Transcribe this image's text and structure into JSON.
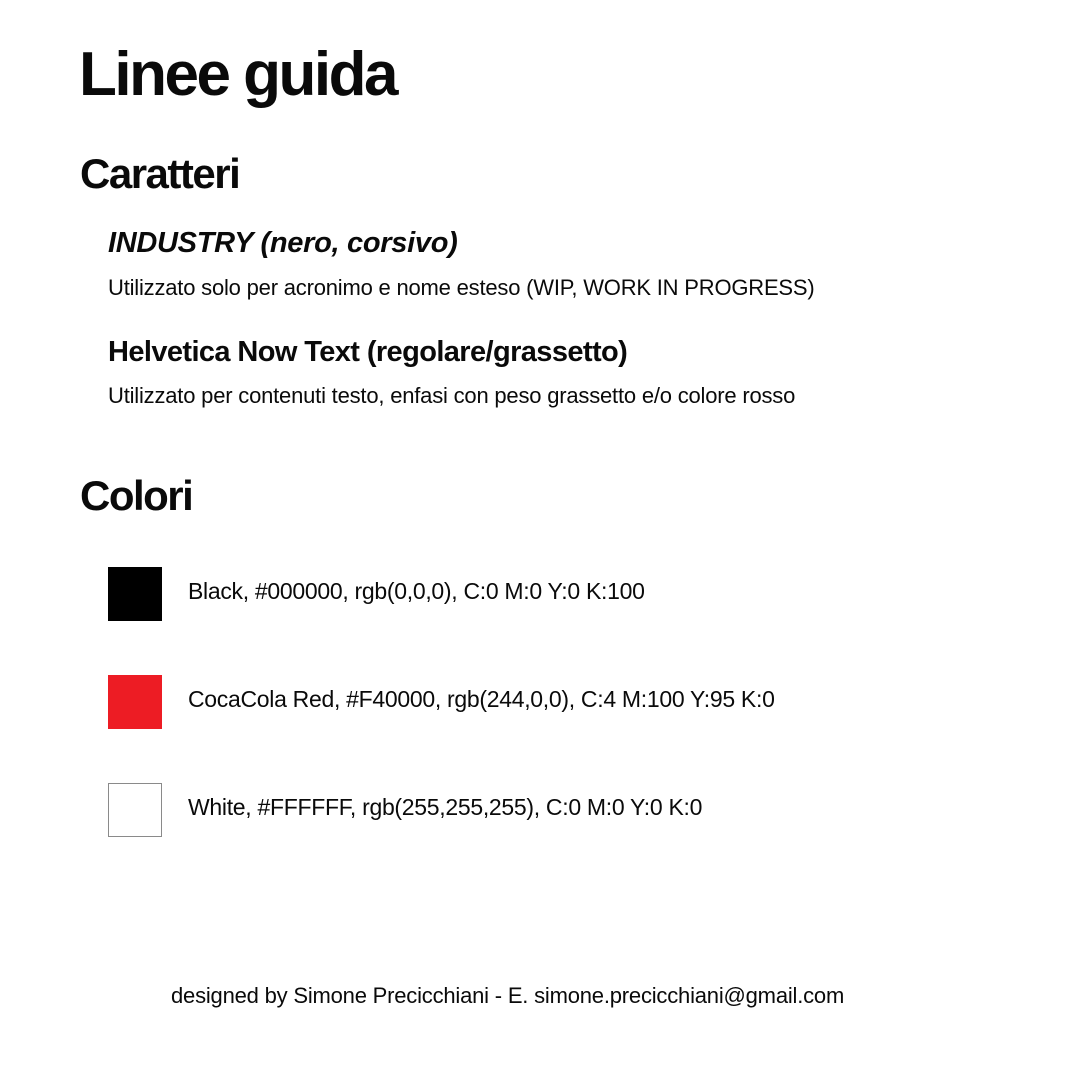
{
  "title": "Linee guida",
  "typography": {
    "heading": "Caratteri",
    "fonts": [
      {
        "name": "INDUSTRY (nero, corsivo)",
        "description": "Utilizzato solo per acronimo e nome esteso (WIP, WORK IN PROGRESS)"
      },
      {
        "name": "Helvetica Now Text (regolare/grassetto)",
        "description": "Utilizzato per contenuti testo, enfasi con peso grassetto e/o colore rosso"
      }
    ]
  },
  "colors": {
    "heading": "Colori",
    "swatches": [
      {
        "label": "Black, #000000, rgb(0,0,0), C:0 M:0 Y:0 K:100",
        "color": "#000000"
      },
      {
        "label": "CocaCola Red, #F40000, rgb(244,0,0), C:4 M:100 Y:95 K:0",
        "color": "#ED1C24"
      },
      {
        "label": "White, #FFFFFF, rgb(255,255,255), C:0 M:0 Y:0 K:0",
        "color": "#FFFFFF",
        "border_color": "#8a8a8a"
      }
    ]
  },
  "footer": "designed by Simone Precicchiani - E. simone.precicchiani@gmail.com"
}
